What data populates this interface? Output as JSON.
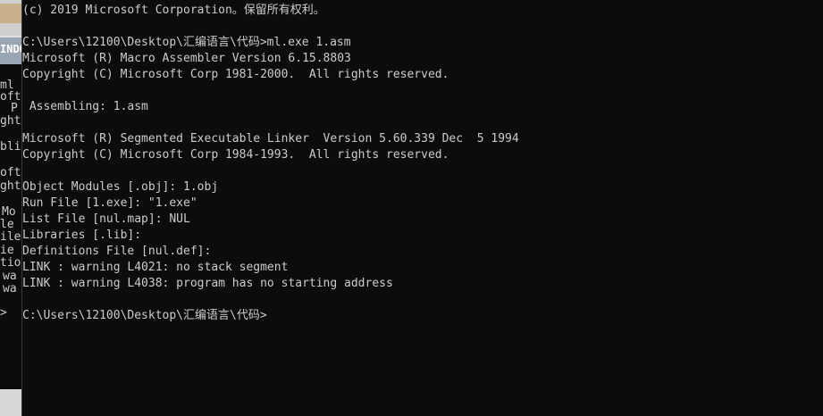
{
  "background_window": {
    "tab_text": "INDO",
    "lines": [
      "ml",
      "oft",
      "P",
      "ght",
      "",
      "bli",
      "",
      "oft",
      "ght",
      "",
      "Mo",
      "le",
      "ile",
      "ie",
      "tio",
      "wa",
      "wa",
      "",
      ">"
    ]
  },
  "console": {
    "lines": [
      "(c) 2019 Microsoft Corporation。保留所有权利。",
      "",
      "C:\\Users\\12100\\Desktop\\汇编语言\\代码>ml.exe 1.asm",
      "Microsoft (R) Macro Assembler Version 6.15.8803",
      "Copyright (C) Microsoft Corp 1981-2000.  All rights reserved.",
      "",
      " Assembling: 1.asm",
      "",
      "Microsoft (R) Segmented Executable Linker  Version 5.60.339 Dec  5 1994",
      "Copyright (C) Microsoft Corp 1984-1993.  All rights reserved.",
      "",
      "Object Modules [.obj]: 1.obj",
      "Run File [1.exe]: \"1.exe\"",
      "List File [nul.map]: NUL",
      "Libraries [.lib]:",
      "Definitions File [nul.def]:",
      "LINK : warning L4021: no stack segment",
      "LINK : warning L4038: program has no starting address",
      "",
      "C:\\Users\\12100\\Desktop\\汇编语言\\代码>"
    ]
  }
}
